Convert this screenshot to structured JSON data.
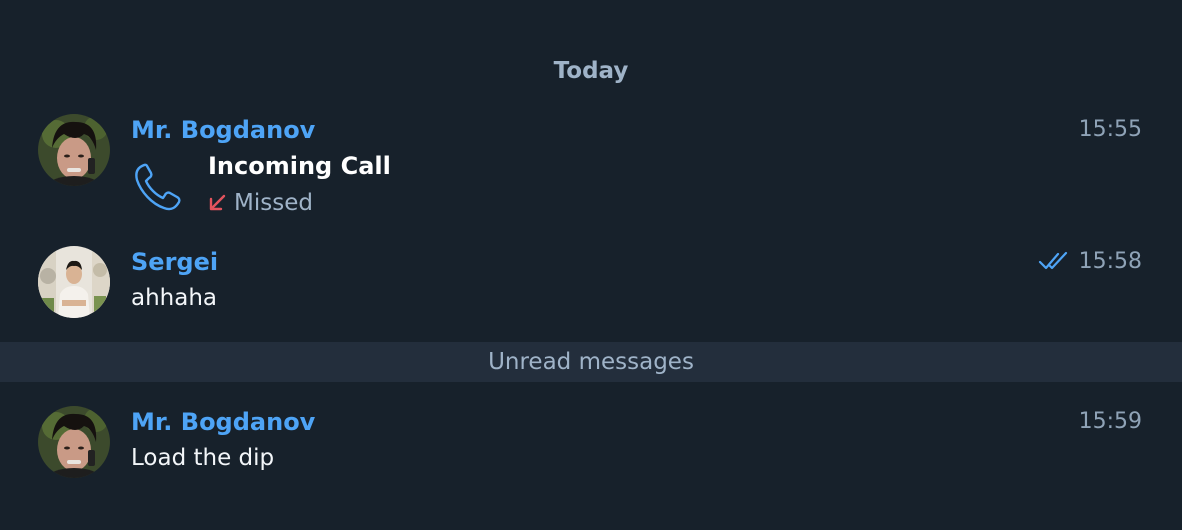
{
  "date_separator": "Today",
  "messages": [
    {
      "sender": "Mr. Bogdanov",
      "time": "15:55",
      "call": {
        "title": "Incoming Call",
        "status": "Missed",
        "status_icon": "missed-arrow-icon"
      },
      "avatar": "bogdanov-avatar"
    },
    {
      "sender": "Sergei",
      "time": "15:58",
      "text": "ahhaha",
      "read_status_icon": "double-check-icon",
      "avatar": "sergei-avatar"
    },
    {
      "sender": "Mr. Bogdanov",
      "time": "15:59",
      "text": "Load the dip",
      "avatar": "bogdanov-avatar"
    }
  ],
  "unread_label": "Unread messages",
  "colors": {
    "background": "#17212b",
    "sender_name": "#4ea4f6",
    "missed_arrow": "#e2535d",
    "unread_bar": "#232e3c",
    "read_check": "#4ea4f6"
  }
}
